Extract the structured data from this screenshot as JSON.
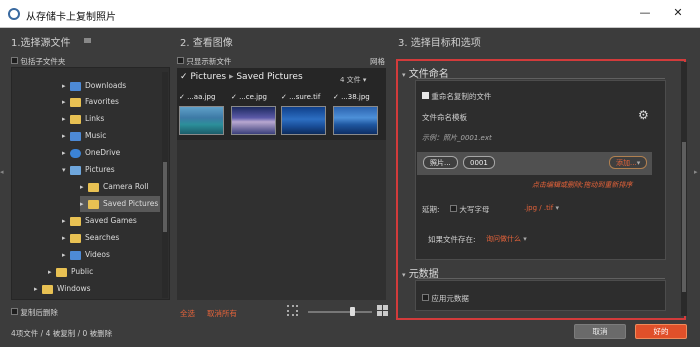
{
  "window": {
    "title": "从存储卡上复制照片",
    "minimize": "—",
    "close": "✕"
  },
  "left": {
    "heading": "1.选择源文件",
    "include_subfolders": "包括子文件夹",
    "tree": [
      "Downloads",
      "Favorites",
      "Links",
      "Music",
      "OneDrive",
      "Pictures",
      "Camera Roll",
      "Saved Pictures",
      "Saved Games",
      "Searches",
      "Videos",
      "Public",
      "Windows"
    ],
    "delete_after_copy": "复制后删除"
  },
  "middle": {
    "heading": "2. 查看图像",
    "only_new_files": "只显示新文件",
    "grid_label": "网格",
    "breadcrumb": {
      "root": "Pictures",
      "sep": "▸",
      "current": "Saved Pictures",
      "count": "4 文件"
    },
    "files": [
      "...aa.jpg",
      "...ce.jpg",
      "...sure.tif",
      "...38.jpg"
    ],
    "select_all": "全选",
    "deselect_all": "取消所有"
  },
  "right": {
    "heading": "3. 选择目标和选项",
    "rename": {
      "title": "文件命名",
      "rename_copied": "重命名复制的文件",
      "template_label": "文件命名模板",
      "example": "示例：照片_0001.ext",
      "tokens": [
        "照片",
        "0001"
      ],
      "add_label": "添加...",
      "hint": "点击编辑或删除;拖动到重新排序",
      "extension_label": "延期:",
      "uppercase_label": "大写字母",
      "extension_value": ".jpg / .tif",
      "if_exists_label": "如果文件存在:",
      "if_exists_value": "询问做什么"
    },
    "metadata": {
      "title": "元数据",
      "apply": "应用元数据"
    }
  },
  "footer": {
    "status": "4项文件 / 4 被复制 / 0 被删除",
    "cancel": "取消",
    "ok": "好的"
  },
  "colors": {
    "accent": "#e0502a",
    "highlight_border": "#d23b3b"
  }
}
